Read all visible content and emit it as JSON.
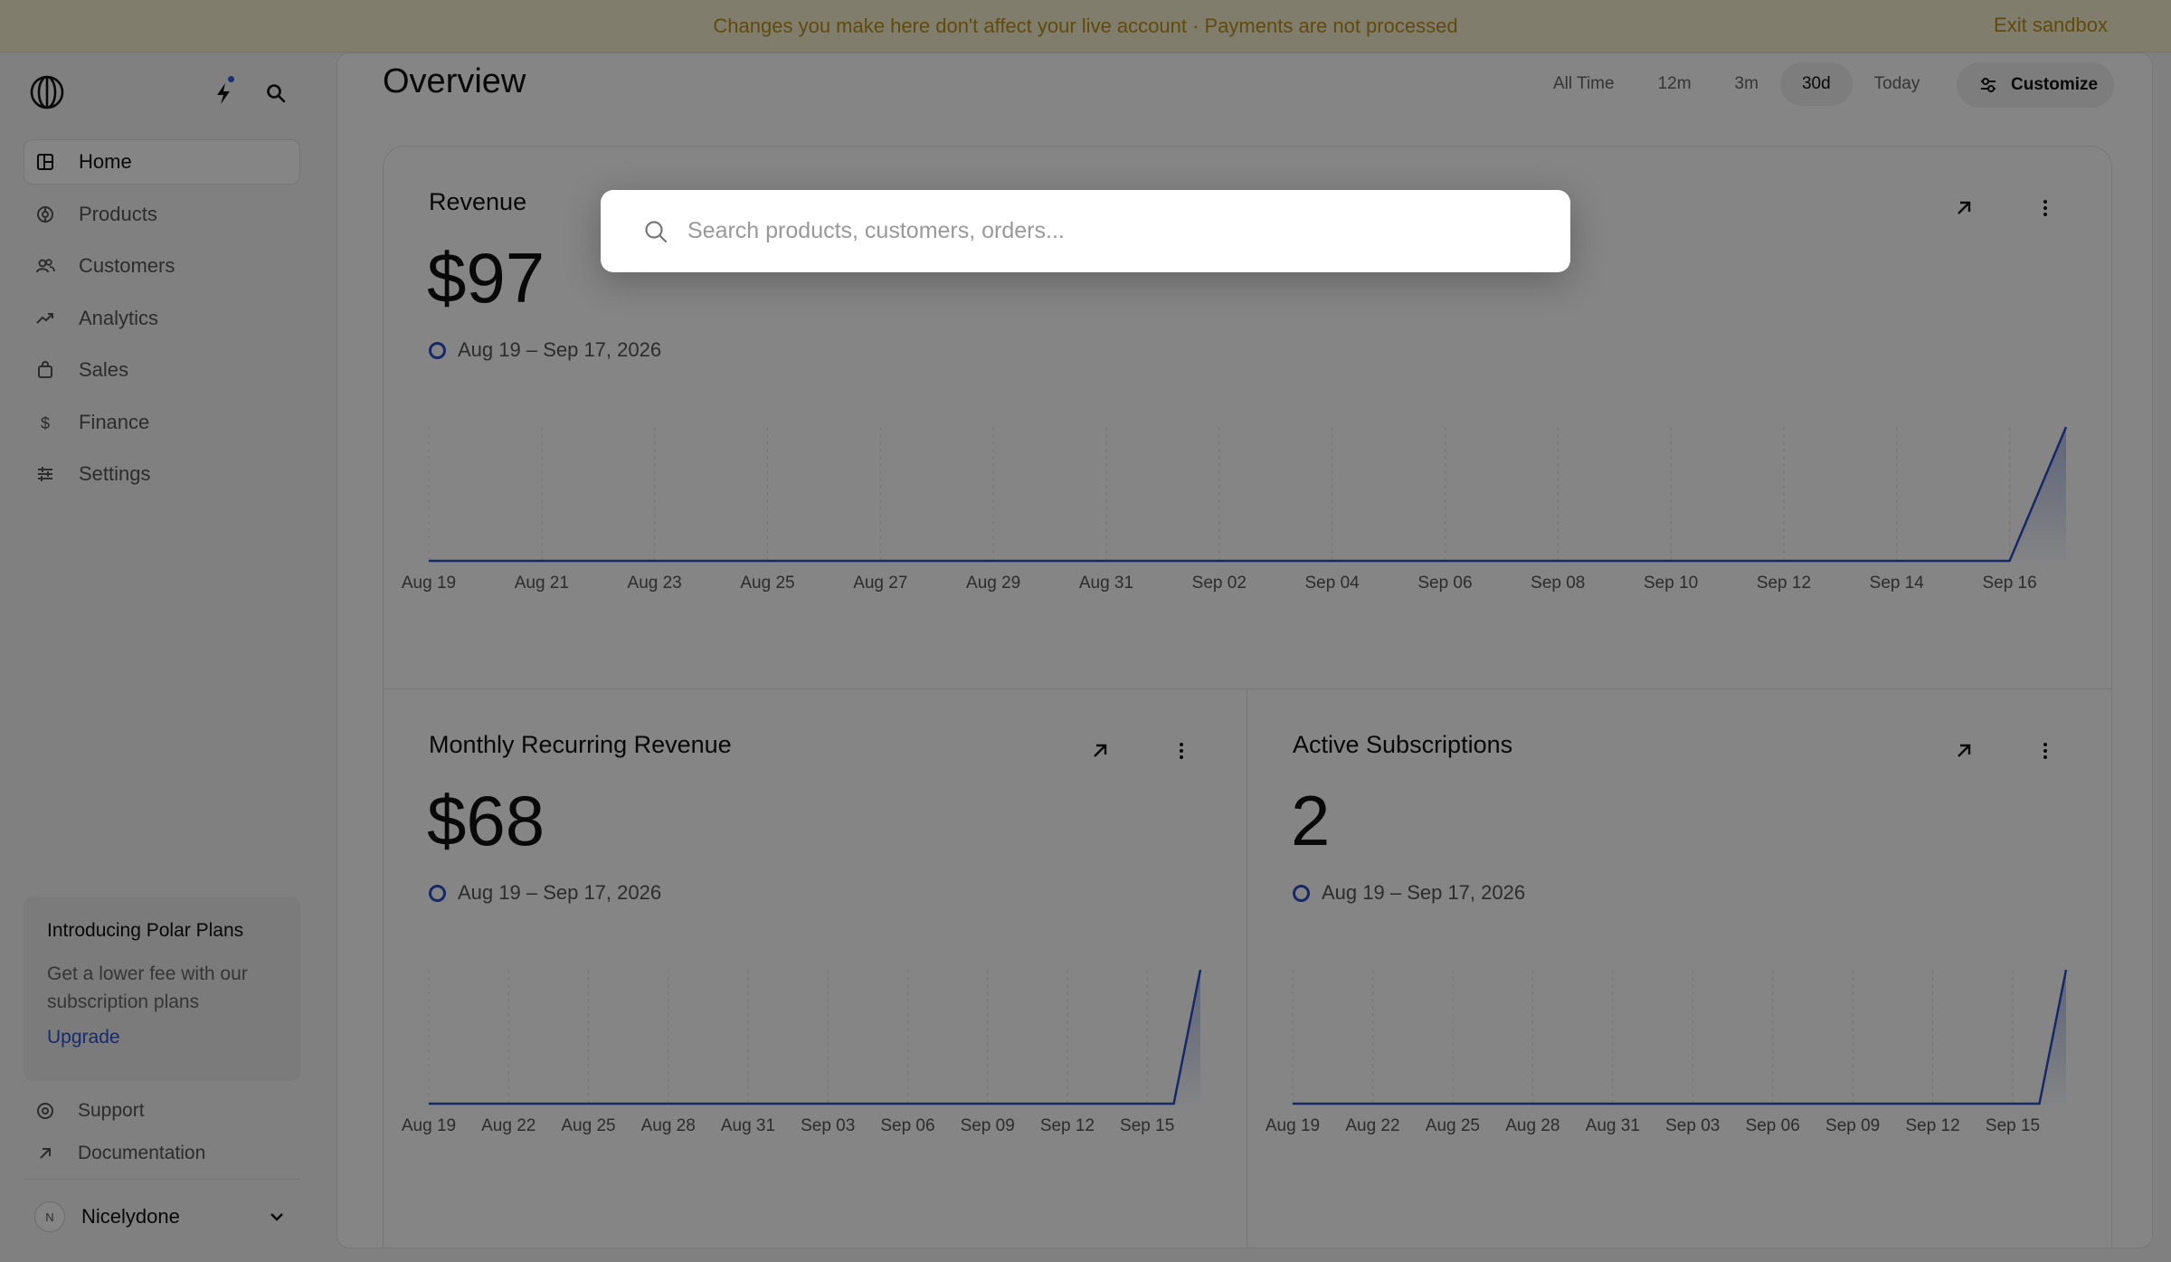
{
  "banner": {
    "text": "Changes you make here don't affect your live account · Payments are not processed",
    "exit_label": "Exit sandbox"
  },
  "sidebar": {
    "items": [
      {
        "label": "Home",
        "icon": "home-icon",
        "active": true
      },
      {
        "label": "Products",
        "icon": "products-icon"
      },
      {
        "label": "Customers",
        "icon": "customers-icon"
      },
      {
        "label": "Analytics",
        "icon": "analytics-icon"
      },
      {
        "label": "Sales",
        "icon": "sales-icon"
      },
      {
        "label": "Finance",
        "icon": "finance-icon"
      },
      {
        "label": "Settings",
        "icon": "settings-icon"
      }
    ],
    "promo": {
      "title": "Introducing Polar Plans",
      "description": "Get a lower fee with our subscription plans",
      "link": "Upgrade"
    },
    "support_label": "Support",
    "docs_label": "Documentation",
    "user": {
      "initial": "N",
      "name": "Nicelydone"
    }
  },
  "header": {
    "title": "Overview",
    "ranges": [
      "All Time",
      "12m",
      "3m",
      "30d",
      "Today"
    ],
    "active_range": "30d",
    "customize_label": "Customize"
  },
  "cards": {
    "revenue": {
      "title": "Revenue",
      "value": "$97",
      "range": "Aug 19 – Sep 17, 2026"
    },
    "mrr": {
      "title": "Monthly Recurring Revenue",
      "value": "$68",
      "range": "Aug 19 – Sep 17, 2026"
    },
    "subs": {
      "title": "Active Subscriptions",
      "value": "2",
      "range": "Aug 19 – Sep 17, 2026"
    }
  },
  "search": {
    "placeholder": "Search products, customers, orders..."
  },
  "colors": {
    "accent": "#2b4fc4",
    "banner_text": "#b7901a"
  },
  "chart_data": [
    {
      "type": "area",
      "title": "Revenue",
      "x_ticks": [
        "Aug 19",
        "Aug 21",
        "Aug 23",
        "Aug 25",
        "Aug 27",
        "Aug 29",
        "Aug 31",
        "Sep 02",
        "Sep 04",
        "Sep 06",
        "Sep 08",
        "Sep 10",
        "Sep 12",
        "Sep 14",
        "Sep 16"
      ],
      "x": [
        "Aug 19",
        "Aug 20",
        "Aug 21",
        "Aug 22",
        "Aug 23",
        "Aug 24",
        "Aug 25",
        "Aug 26",
        "Aug 27",
        "Aug 28",
        "Aug 29",
        "Aug 30",
        "Aug 31",
        "Sep 01",
        "Sep 02",
        "Sep 03",
        "Sep 04",
        "Sep 05",
        "Sep 06",
        "Sep 07",
        "Sep 08",
        "Sep 09",
        "Sep 10",
        "Sep 11",
        "Sep 12",
        "Sep 13",
        "Sep 14",
        "Sep 15",
        "Sep 16",
        "Sep 17"
      ],
      "values": [
        0,
        0,
        0,
        0,
        0,
        0,
        0,
        0,
        0,
        0,
        0,
        0,
        0,
        0,
        0,
        0,
        0,
        0,
        0,
        0,
        0,
        0,
        0,
        0,
        0,
        0,
        0,
        0,
        0,
        97
      ],
      "grid": true
    },
    {
      "type": "area",
      "title": "Monthly Recurring Revenue",
      "x_ticks": [
        "Aug 19",
        "Aug 22",
        "Aug 25",
        "Aug 28",
        "Aug 31",
        "Sep 03",
        "Sep 06",
        "Sep 09",
        "Sep 12",
        "Sep 15"
      ],
      "x": [
        "Aug 19",
        "Aug 20",
        "Aug 21",
        "Aug 22",
        "Aug 23",
        "Aug 24",
        "Aug 25",
        "Aug 26",
        "Aug 27",
        "Aug 28",
        "Aug 29",
        "Aug 30",
        "Aug 31",
        "Sep 01",
        "Sep 02",
        "Sep 03",
        "Sep 04",
        "Sep 05",
        "Sep 06",
        "Sep 07",
        "Sep 08",
        "Sep 09",
        "Sep 10",
        "Sep 11",
        "Sep 12",
        "Sep 13",
        "Sep 14",
        "Sep 15",
        "Sep 16",
        "Sep 17"
      ],
      "values": [
        0,
        0,
        0,
        0,
        0,
        0,
        0,
        0,
        0,
        0,
        0,
        0,
        0,
        0,
        0,
        0,
        0,
        0,
        0,
        0,
        0,
        0,
        0,
        0,
        0,
        0,
        0,
        0,
        0,
        68
      ],
      "grid": true
    },
    {
      "type": "area",
      "title": "Active Subscriptions",
      "x_ticks": [
        "Aug 19",
        "Aug 22",
        "Aug 25",
        "Aug 28",
        "Aug 31",
        "Sep 03",
        "Sep 06",
        "Sep 09",
        "Sep 12",
        "Sep 15"
      ],
      "x": [
        "Aug 19",
        "Aug 20",
        "Aug 21",
        "Aug 22",
        "Aug 23",
        "Aug 24",
        "Aug 25",
        "Aug 26",
        "Aug 27",
        "Aug 28",
        "Aug 29",
        "Aug 30",
        "Aug 31",
        "Sep 01",
        "Sep 02",
        "Sep 03",
        "Sep 04",
        "Sep 05",
        "Sep 06",
        "Sep 07",
        "Sep 08",
        "Sep 09",
        "Sep 10",
        "Sep 11",
        "Sep 12",
        "Sep 13",
        "Sep 14",
        "Sep 15",
        "Sep 16",
        "Sep 17"
      ],
      "values": [
        0,
        0,
        0,
        0,
        0,
        0,
        0,
        0,
        0,
        0,
        0,
        0,
        0,
        0,
        0,
        0,
        0,
        0,
        0,
        0,
        0,
        0,
        0,
        0,
        0,
        0,
        0,
        0,
        0,
        2
      ],
      "grid": true
    }
  ]
}
